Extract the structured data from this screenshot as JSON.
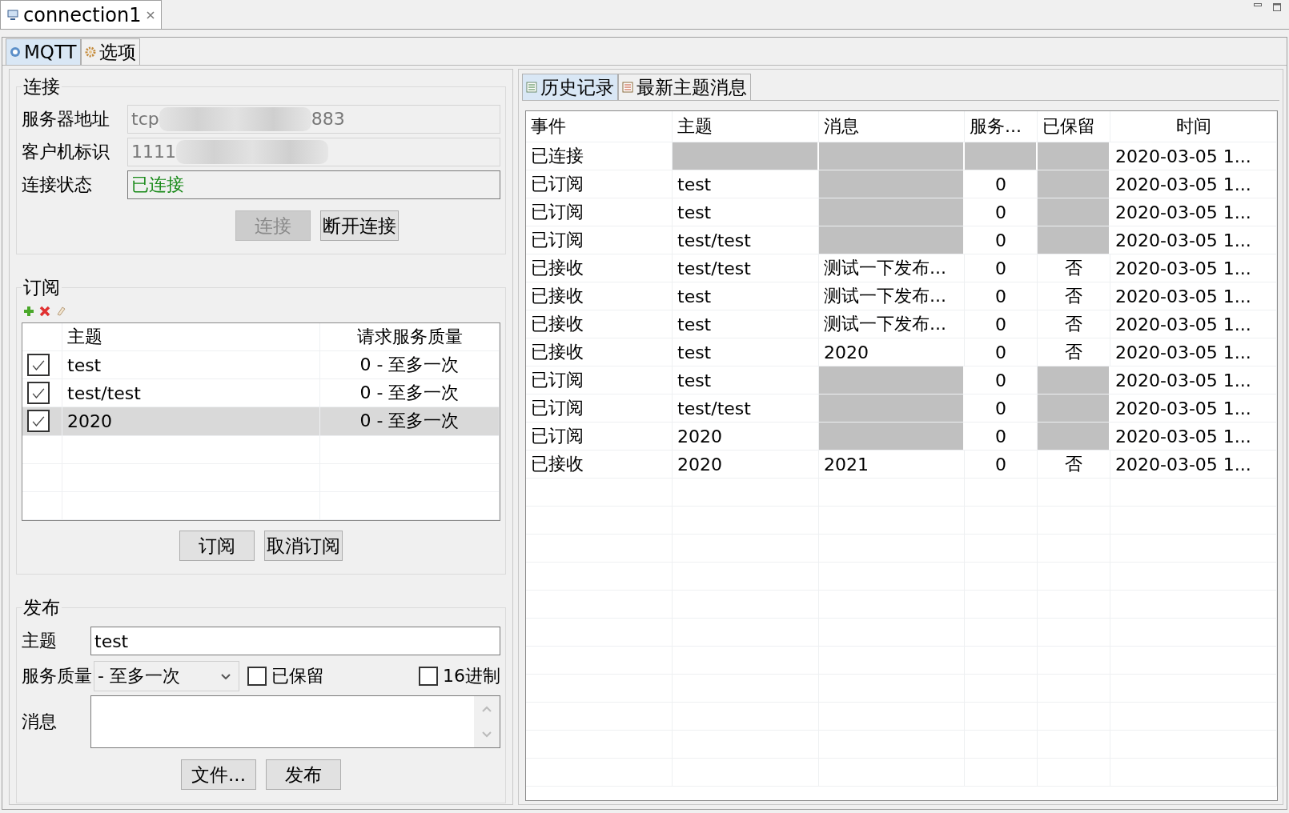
{
  "window_tab": {
    "title": "connection1"
  },
  "tabs": [
    {
      "label": "MQTT",
      "selected": true
    },
    {
      "label": "选项",
      "selected": false
    }
  ],
  "connection": {
    "title": "连接",
    "fields": [
      {
        "label": "服务器地址",
        "kind": "redacted",
        "value": "tcp",
        "tail": "883"
      },
      {
        "label": "客户机标识",
        "kind": "redacted",
        "value": "1111"
      },
      {
        "label": "连接状态",
        "kind": "status",
        "value": "已连接"
      }
    ],
    "buttons": [
      {
        "label": "连接",
        "disabled": true
      },
      {
        "label": "断开连接",
        "disabled": false
      }
    ]
  },
  "subscribe": {
    "title": "订阅",
    "columns": [
      "主题",
      "请求服务质量"
    ],
    "rows": [
      {
        "topic": "test",
        "qos": "0 - 至多一次",
        "checked": true,
        "selected": false
      },
      {
        "topic": "test/test",
        "qos": "0 - 至多一次",
        "checked": true,
        "selected": false
      },
      {
        "topic": "2020",
        "qos": "0 - 至多一次",
        "checked": true,
        "selected": true
      }
    ],
    "buttons": [
      {
        "label": "订阅",
        "disabled": false
      },
      {
        "label": "取消订阅",
        "disabled": false
      }
    ]
  },
  "publish": {
    "title": "发布",
    "topic_label": "主题",
    "topic": "test",
    "qos_label": "服务质量",
    "qos": "- 至多一次",
    "options": [
      {
        "label": "已保留",
        "checked": false
      },
      {
        "label": "16进制",
        "checked": false
      }
    ],
    "message_label": "消息",
    "buttons": [
      {
        "label": "文件...",
        "disabled": false
      },
      {
        "label": "发布",
        "disabled": false
      }
    ]
  },
  "history_tabs": [
    {
      "label": "历史记录",
      "selected": true
    },
    {
      "label": "最新主题消息",
      "selected": false
    }
  ],
  "history": {
    "columns": [
      "事件",
      "主题",
      "消息",
      "服务...",
      "已保留",
      "时间"
    ],
    "rows": [
      [
        "已连接",
        null,
        null,
        null,
        null,
        "2020-03-05 1..."
      ],
      [
        "已订阅",
        "test",
        null,
        "0",
        null,
        "2020-03-05 1..."
      ],
      [
        "已订阅",
        "test",
        null,
        "0",
        null,
        "2020-03-05 1..."
      ],
      [
        "已订阅",
        "test/test",
        null,
        "0",
        null,
        "2020-03-05 1..."
      ],
      [
        "已接收",
        "test/test",
        "测试一下发布...",
        "0",
        "否",
        "2020-03-05 1..."
      ],
      [
        "已接收",
        "test",
        "测试一下发布...",
        "0",
        "否",
        "2020-03-05 1..."
      ],
      [
        "已接收",
        "test",
        "测试一下发布...",
        "0",
        "否",
        "2020-03-05 1..."
      ],
      [
        "已接收",
        "test",
        "2020",
        "0",
        "否",
        "2020-03-05 1..."
      ],
      [
        "已订阅",
        "test",
        null,
        "0",
        null,
        "2020-03-05 1..."
      ],
      [
        "已订阅",
        "test/test",
        null,
        "0",
        null,
        "2020-03-05 1..."
      ],
      [
        "已订阅",
        "2020",
        null,
        "0",
        null,
        "2020-03-05 1..."
      ],
      [
        "已接收",
        "2020",
        "2021",
        "0",
        "否",
        "2020-03-05 1..."
      ]
    ]
  }
}
